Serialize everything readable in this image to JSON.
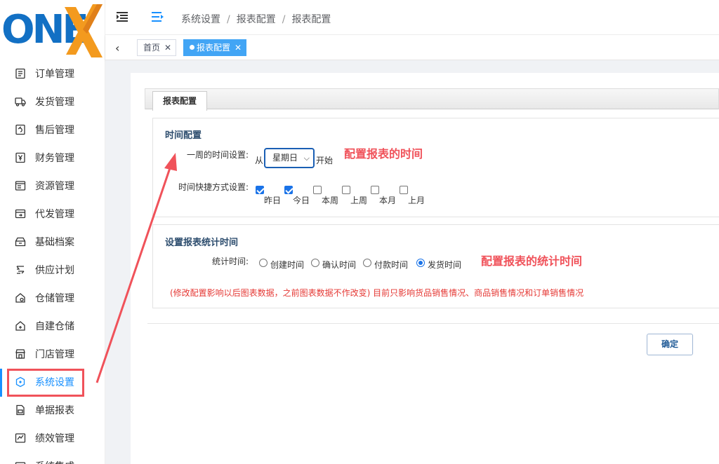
{
  "brand": {
    "logo_text": "ONEX",
    "logo_colors": {
      "blue": "#1270c4",
      "orange": "#f39a1e"
    }
  },
  "sidebar": {
    "items": [
      {
        "label": "订单管理",
        "icon": "order-list-icon"
      },
      {
        "label": "发货管理",
        "icon": "truck-icon"
      },
      {
        "label": "售后管理",
        "icon": "return-icon"
      },
      {
        "label": "财务管理",
        "icon": "yen-icon"
      },
      {
        "label": "资源管理",
        "icon": "resource-icon"
      },
      {
        "label": "代发管理",
        "icon": "dropship-icon"
      },
      {
        "label": "基础档案",
        "icon": "archive-icon"
      },
      {
        "label": "供应计划",
        "icon": "supply-icon"
      },
      {
        "label": "仓储管理",
        "icon": "warehouse-icon"
      },
      {
        "label": "自建仓储",
        "icon": "home-plus-icon"
      },
      {
        "label": "门店管理",
        "icon": "store-icon"
      },
      {
        "label": "系统设置",
        "icon": "settings-hex-icon",
        "active": true
      },
      {
        "label": "单据报表",
        "icon": "report-icon"
      },
      {
        "label": "绩效管理",
        "icon": "kpi-icon"
      },
      {
        "label": "系统集成",
        "icon": "integration-icon"
      }
    ]
  },
  "header": {
    "breadcrumb": [
      "系统设置",
      "报表配置",
      "报表配置"
    ]
  },
  "tabs": [
    {
      "label": "首页"
    },
    {
      "label": "报表配置",
      "active": true
    }
  ],
  "main": {
    "tab_title": "报表配置",
    "time_config": {
      "title": "时间配置",
      "week_label": "一周的时间设置:",
      "from_text": "从",
      "week_select_value": "星期日",
      "start_text": "开始",
      "shortcut_label": "时间快捷方式设置:",
      "shortcuts": [
        {
          "label": "昨日",
          "checked": true
        },
        {
          "label": "今日",
          "checked": true
        },
        {
          "label": "本周",
          "checked": false
        },
        {
          "label": "上周",
          "checked": false
        },
        {
          "label": "本月",
          "checked": false
        },
        {
          "label": "上月",
          "checked": false
        }
      ]
    },
    "stat_config": {
      "title": "设置报表统计时间",
      "stat_label": "统计时间:",
      "options": [
        {
          "label": "创建时间",
          "checked": false
        },
        {
          "label": "确认时间",
          "checked": false
        },
        {
          "label": "付款时间",
          "checked": false
        },
        {
          "label": "发货时间",
          "checked": true
        }
      ],
      "note": "(修改配置影响以后图表数据，之前图表数据不作改变) 目前只影响货品销售情况、商品销售情况和订单销售情况"
    },
    "ok_button": "确定"
  },
  "annotations": {
    "time": "配置报表的时间",
    "stat": "配置报表的统计时间",
    "color": "#f0525a"
  }
}
